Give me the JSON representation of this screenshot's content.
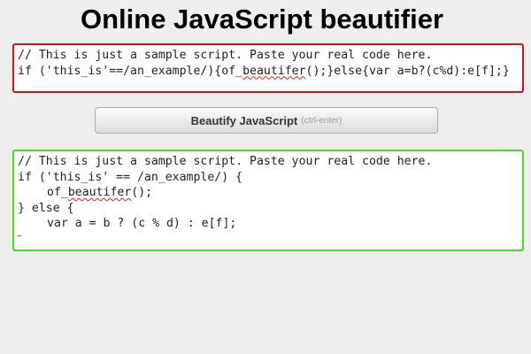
{
  "page": {
    "title": "Online JavaScript beautifier"
  },
  "input": {
    "line1": "// This is just a sample script. Paste your real code here.",
    "line2_pre": "if ('this_is'==/an_example/){of_",
    "line2_misspelled": "beautifer",
    "line2_post": "();}else{var a=b?(c%d):e[f];}"
  },
  "button": {
    "label": "Beautify JavaScript",
    "hint": "(ctrl-enter)"
  },
  "output": {
    "line1": "// This is just a sample script. Paste your real code here.",
    "line2": "if ('this_is' == /an_example/) {",
    "line3_pre": "of_",
    "line3_misspelled": "beautifer",
    "line3_post": "();",
    "line4": "} else {",
    "line5": "var a = b ? (c % d) : e[f];"
  },
  "colors": {
    "input_border": "#dd1111",
    "output_border": "#44dd22",
    "spell_underline": "#e02020",
    "background": "#eeeeee"
  }
}
